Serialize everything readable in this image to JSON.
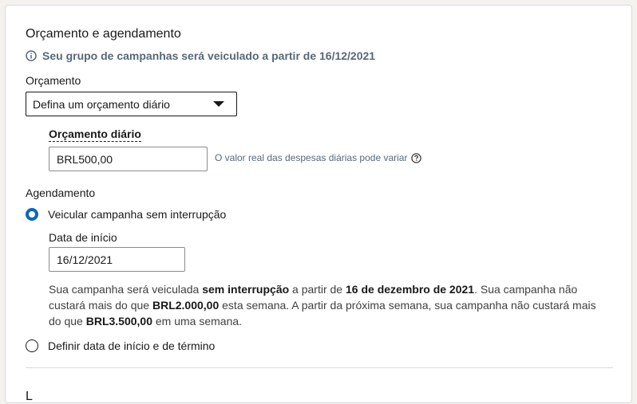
{
  "section": {
    "title": "Orçamento e agendamento",
    "info": "Seu grupo de campanhas será veiculado a partir de 16/12/2021"
  },
  "budget": {
    "label": "Orçamento",
    "select_value": "Defina um orçamento diário",
    "daily_label": "Orçamento diário",
    "daily_value": "BRL500,00",
    "hint": "O valor real das despesas diárias pode variar"
  },
  "schedule": {
    "label": "Agendamento",
    "option_continuous": "Veicular campanha sem interrupção",
    "option_continuous_selected": true,
    "start_date_label": "Data de início",
    "start_date_value": "16/12/2021",
    "desc": {
      "p1": "Sua campanha será veiculada ",
      "b1": "sem interrupção",
      "p2": " a partir de ",
      "b2": "16 de dezembro de 2021",
      "p3": ". Sua campanha não custará mais do que ",
      "b3": "BRL2.000,00",
      "p4": " esta semana. A partir da próxima semana, sua campanha não custará mais do que ",
      "b4": "BRL3.500,00",
      "p5": " em uma semana."
    },
    "option_range": "Definir data de início e de término",
    "option_range_selected": false
  },
  "next_section_partial": "L",
  "colors": {
    "accent": "#0a66c2",
    "info_text": "#56687a"
  },
  "icons": {
    "info": "info-circle-icon",
    "help": "question-circle-icon",
    "caret": "caret-down-icon"
  }
}
